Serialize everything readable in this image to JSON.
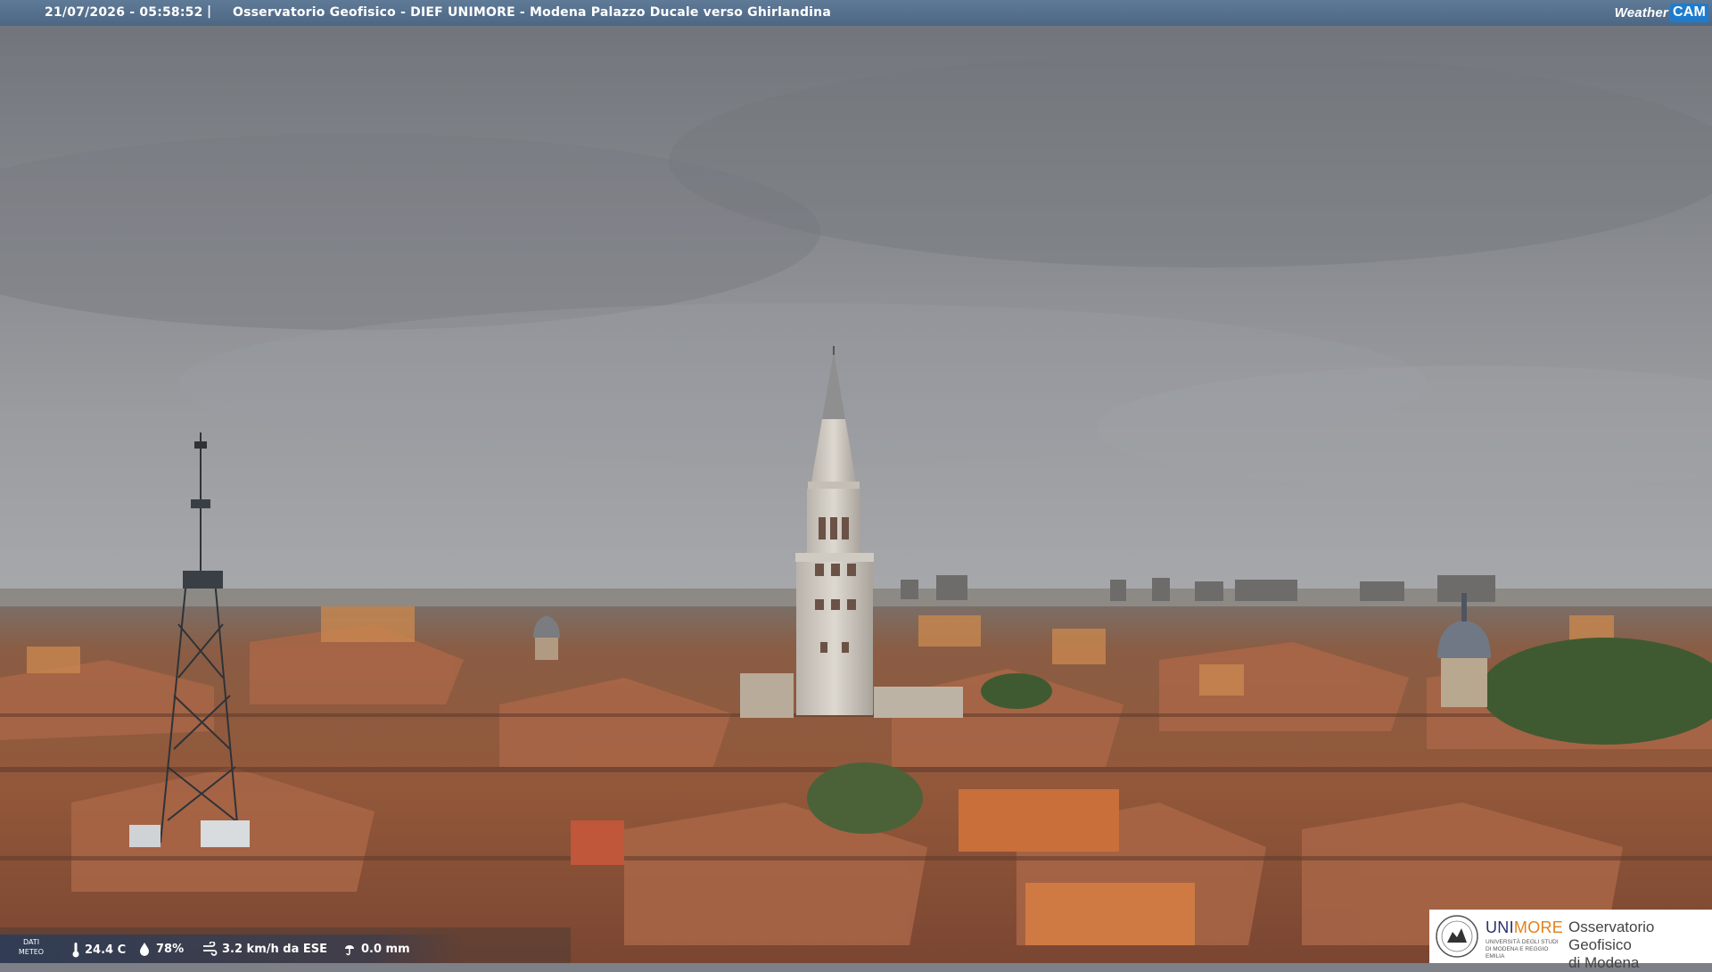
{
  "overlay": {
    "timestamp": "21/07/2026 - 05:58:52",
    "separator": "|",
    "caption": "Osservatorio Geofisico - DIEF UNIMORE - Modena Palazzo Ducale verso Ghirlandina"
  },
  "brand": {
    "part1": "Weather",
    "part2": "CAM"
  },
  "meteo": {
    "label_line1": "DATI",
    "label_line2": "METEO",
    "temperature": "24.4 C",
    "humidity": "78%",
    "wind": "3.2 km/h da ESE",
    "rain": "0.0 mm",
    "icons": [
      "thermometer-icon",
      "humidity-drop-icon",
      "wind-icon",
      "rain-icon"
    ]
  },
  "logo": {
    "uni": "UNI",
    "more": "MORE",
    "uni_sub": "UNIVERSITÀ DEGLI STUDI DI MODENA E REGGIO EMILIA",
    "obs_line1": "Osservatorio Geofisico",
    "obs_line2": "di Modena"
  },
  "colors": {
    "sky": "#8c8f94",
    "roofs": "#9a5a3c",
    "tower": "#d9d4cc",
    "overlay_bar": "#56708e",
    "logo_orange": "#e0811d",
    "logo_navy": "#2b2f6e"
  }
}
